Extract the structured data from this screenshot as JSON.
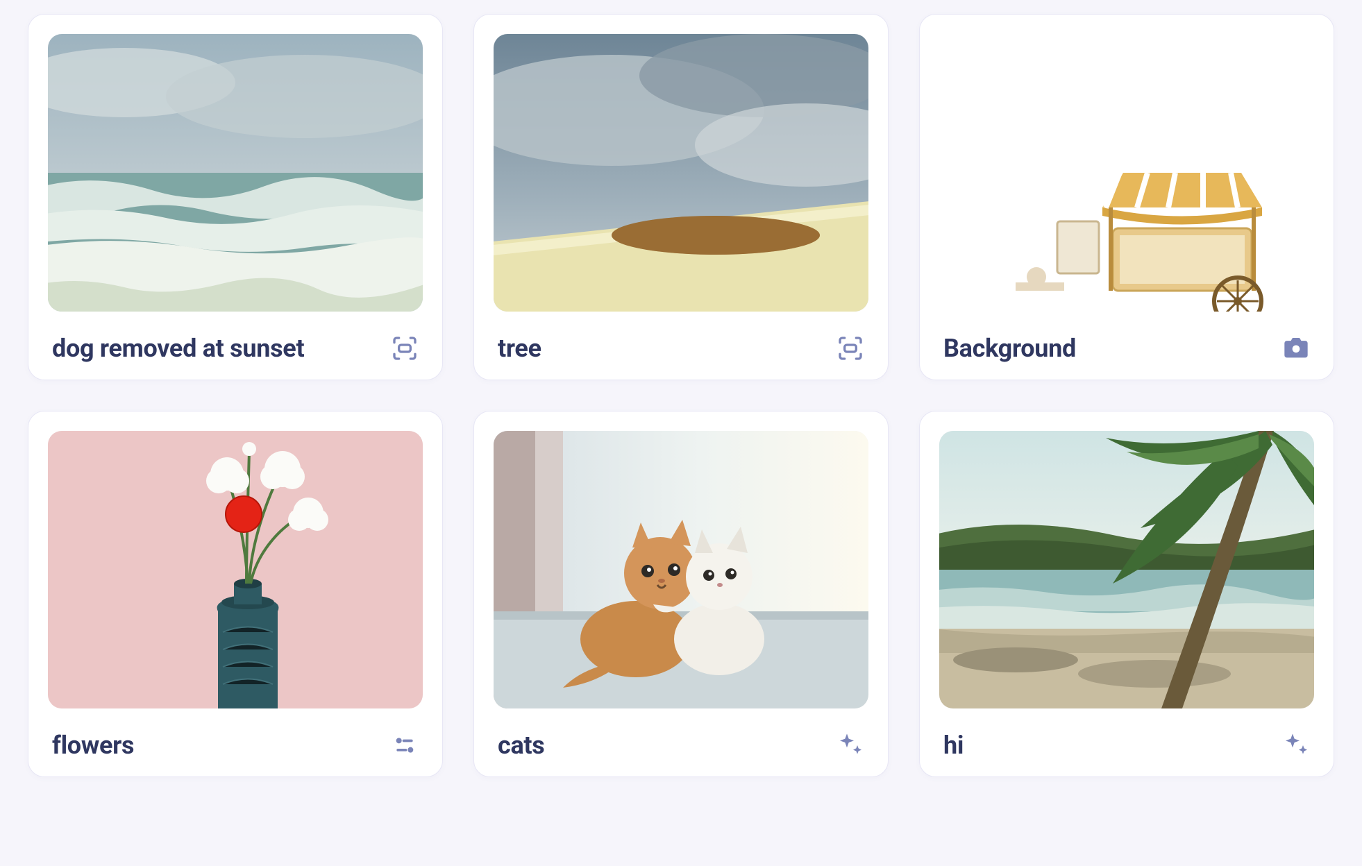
{
  "cards": [
    {
      "title": "dog removed at sunset",
      "icon": "scan",
      "thumb": "ocean"
    },
    {
      "title": "tree",
      "icon": "scan",
      "thumb": "field"
    },
    {
      "title": "Background",
      "icon": "camera",
      "thumb": "cart"
    },
    {
      "title": "flowers",
      "icon": "sliders",
      "thumb": "vase"
    },
    {
      "title": "cats",
      "icon": "sparkle",
      "thumb": "cats"
    },
    {
      "title": "hi",
      "icon": "sparkle",
      "thumb": "beach"
    }
  ],
  "colors": {
    "title": "#2f3760",
    "icon": "#7a84b8",
    "card_border": "#e7e6f5"
  }
}
